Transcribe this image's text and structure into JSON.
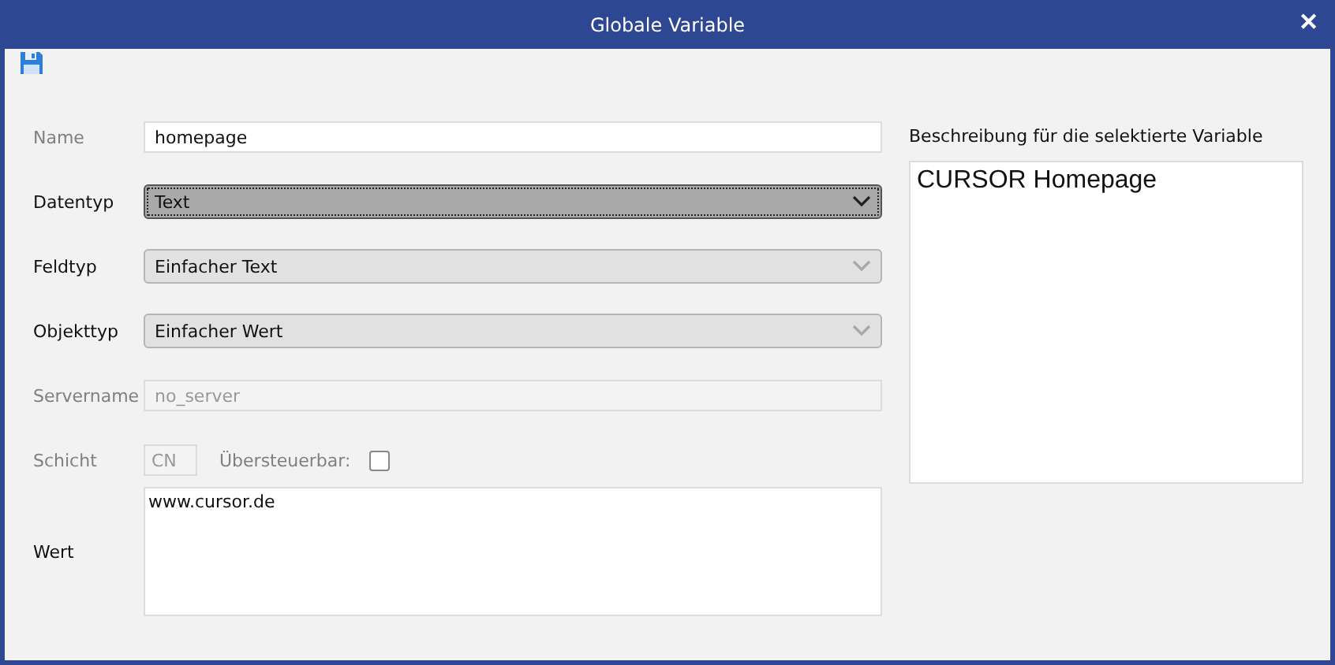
{
  "window": {
    "title": "Globale Variable",
    "close": "✕"
  },
  "form": {
    "rows": [
      {
        "kind": "text",
        "label": "Name",
        "value": "homepage",
        "disabled": true
      },
      {
        "kind": "select",
        "label": "Datentyp",
        "value": "Text",
        "disabled": false,
        "focused": true
      },
      {
        "kind": "select",
        "label": "Feldtyp",
        "value": "Einfacher Text",
        "disabled": true,
        "focused": false
      },
      {
        "kind": "select",
        "label": "Objekttyp",
        "value": "Einfacher Wert",
        "disabled": true,
        "focused": false
      },
      {
        "kind": "text",
        "label": "Servername",
        "value": "no_server",
        "disabled": true,
        "readonly": true
      },
      {
        "kind": "layer",
        "label": "Schicht",
        "value": "CN",
        "checkbox_label": "Übersteuerbar:",
        "checked": false,
        "disabled": true
      },
      {
        "kind": "textarea",
        "label": "Wert",
        "value": "www.cursor.de",
        "disabled": false
      }
    ]
  },
  "description": {
    "label": "Beschreibung für die selektierte Variable",
    "value": "CURSOR Homepage"
  }
}
